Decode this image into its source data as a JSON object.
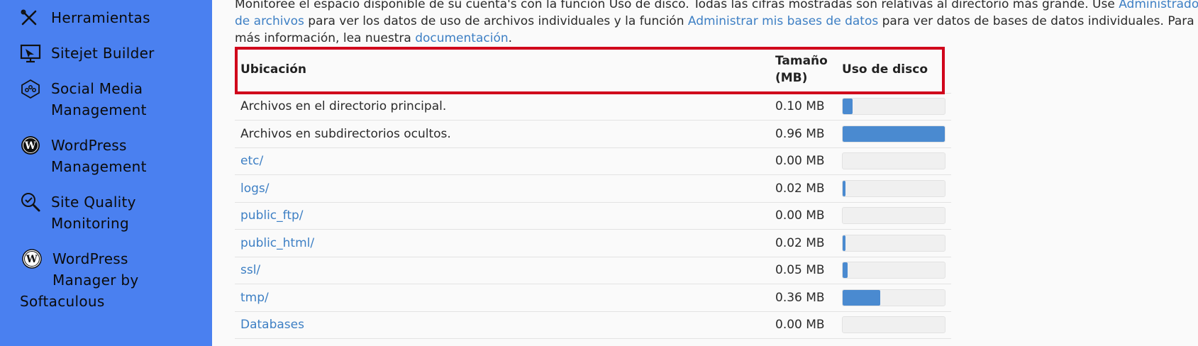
{
  "sidebar": {
    "items": [
      {
        "label": "Herramientas",
        "icon": "tools-icon"
      },
      {
        "label": "Sitejet Builder",
        "icon": "sitejet-icon"
      },
      {
        "label": "Social Media\nManagement",
        "icon": "social-media-icon"
      },
      {
        "label": "WordPress\nManagement",
        "icon": "wordpress-icon"
      },
      {
        "label": "Site Quality\nMonitoring",
        "icon": "site-quality-icon"
      },
      {
        "label": "WordPress\nManager by",
        "label2": "Softaculous",
        "icon": "wordpress-icon"
      }
    ]
  },
  "intro": {
    "line1_pre": "Monitoree el espacio disponible de su cuenta's con la función Uso de disco. Todas las cifras mostradas son relativas al directorio más grande. Use ",
    "link1": "Administrador de archivos",
    "line_mid": " para ver los datos de uso de archivos individuales y la función ",
    "link2": "Administrar mis bases de datos",
    "line_mid2": " para ver datos de bases de datos individuales. Para más información, lea nuestra ",
    "link3": "documentación",
    "line_end": "."
  },
  "table": {
    "headers": {
      "location": "Ubicación",
      "size": "Tamaño (MB)",
      "usage": "Uso de disco"
    },
    "rows": [
      {
        "location": "Archivos en el directorio principal.",
        "size": "0.10 MB",
        "fraction": 0.1,
        "link": false
      },
      {
        "location": "Archivos en subdirectorios ocultos.",
        "size": "0.96 MB",
        "fraction": 1.0,
        "link": false
      },
      {
        "location": "etc/",
        "size": "0.00 MB",
        "fraction": 0.0,
        "link": true
      },
      {
        "location": "logs/",
        "size": "0.02 MB",
        "fraction": 0.02,
        "link": true
      },
      {
        "location": "public_ftp/",
        "size": "0.00 MB",
        "fraction": 0.0,
        "link": true
      },
      {
        "location": "public_html/",
        "size": "0.02 MB",
        "fraction": 0.02,
        "link": true
      },
      {
        "location": "ssl/",
        "size": "0.05 MB",
        "fraction": 0.05,
        "link": true
      },
      {
        "location": "tmp/",
        "size": "0.36 MB",
        "fraction": 0.37,
        "link": true
      },
      {
        "location": "Databases",
        "size": "0.00 MB",
        "fraction": 0.0,
        "link": true
      }
    ]
  },
  "colors": {
    "sidebar_bg": "#4a80f0",
    "link": "#3d7fc4",
    "bar": "#4a8ad0",
    "highlight": "#d0021b"
  }
}
